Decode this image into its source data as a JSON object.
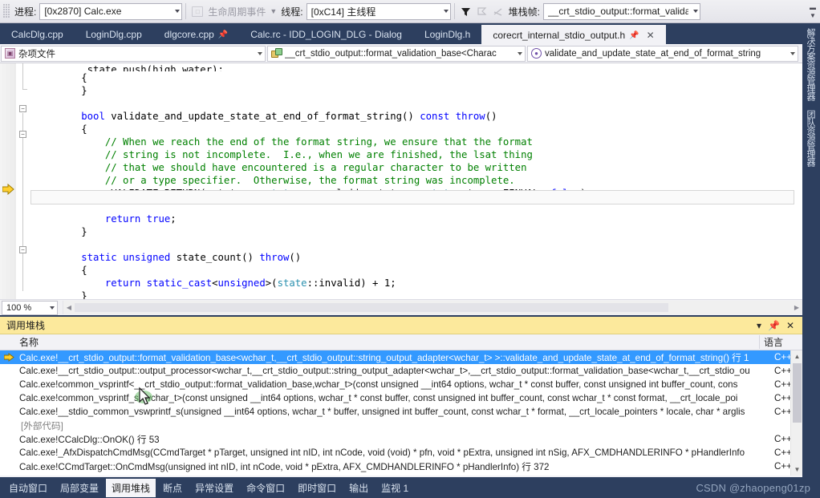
{
  "debug_toolbar": {
    "process_label": "进程:",
    "process_value": "[0x2870] Calc.exe",
    "lifecycle_label": "生命周期事件",
    "thread_label": "线程:",
    "thread_value": "[0xC14] 主线程",
    "frame_label": "堆栈帧:",
    "frame_value": "__crt_stdio_output::format_validation_b",
    "filter_icon": "funnel-icon",
    "flag_icon": "flag-icon",
    "nocross_icon": "no-cross-icon",
    "overflow_icon": "toolbar-overflow-icon"
  },
  "editor_tabs": [
    {
      "label": "CalcDlg.cpp",
      "active": false,
      "pinned": false
    },
    {
      "label": "LoginDlg.cpp",
      "active": false,
      "pinned": false
    },
    {
      "label": "dlgcore.cpp",
      "active": false,
      "pinned": true
    },
    {
      "label": "Calc.rc - IDD_LOGIN_DLG - Dialog",
      "active": false,
      "pinned": false
    },
    {
      "label": "LoginDlg.h",
      "active": false,
      "pinned": false
    },
    {
      "label": "corecrt_internal_stdio_output.h",
      "active": true,
      "pinned": true
    }
  ],
  "navbar": {
    "project": "杂项文件",
    "project_icon": "misc-files-icon",
    "class": "__crt_stdio_output::format_validation_base<Charac",
    "class_icon": "class-icon",
    "member": "validate_and_update_state_at_end_of_format_string",
    "member_icon": "method-icon"
  },
  "editor": {
    "zoom": "100 %",
    "lines": [
      {
        "indent": 2,
        "tokens": [
          {
            "t": "_state.push(high_water);",
            "c": "plain"
          }
        ],
        "clipped": true
      },
      {
        "indent": 2,
        "tokens": [
          {
            "t": "{",
            "c": "plain"
          }
        ]
      },
      {
        "indent": 2,
        "tokens": [
          {
            "t": "}",
            "c": "plain"
          }
        ]
      },
      {
        "indent": 0,
        "tokens": []
      },
      {
        "indent": 2,
        "tokens": [
          {
            "t": "bool",
            "c": "kw"
          },
          {
            "t": " validate_and_update_state_at_end_of_format_string() ",
            "c": "plain"
          },
          {
            "t": "const",
            "c": "kw"
          },
          {
            "t": " ",
            "c": "plain"
          },
          {
            "t": "throw",
            "c": "kw"
          },
          {
            "t": "()",
            "c": "plain"
          }
        ]
      },
      {
        "indent": 2,
        "tokens": [
          {
            "t": "{",
            "c": "plain"
          }
        ]
      },
      {
        "indent": 3,
        "tokens": [
          {
            "t": "// When we reach the end of the format string, we ensure that the format",
            "c": "cmt"
          }
        ]
      },
      {
        "indent": 3,
        "tokens": [
          {
            "t": "// string is not incomplete.  I.e., when we are finished, the lsat thing",
            "c": "cmt"
          }
        ]
      },
      {
        "indent": 3,
        "tokens": [
          {
            "t": "// that we should have encountered is a regular character to be written",
            "c": "cmt"
          }
        ]
      },
      {
        "indent": 3,
        "tokens": [
          {
            "t": "// or a type specifier.  Otherwise, the format string was incomplete.",
            "c": "cmt"
          }
        ]
      },
      {
        "indent": 3,
        "current": true,
        "tokens": [
          {
            "t": "_VALIDATE_RETURN(_state == ",
            "c": "plain"
          },
          {
            "t": "state",
            "c": "typ"
          },
          {
            "t": "::normal || _state == ",
            "c": "plain"
          },
          {
            "t": "state",
            "c": "typ"
          },
          {
            "t": "::type, EINVAL, ",
            "c": "plain"
          },
          {
            "t": "false",
            "c": "kw"
          },
          {
            "t": ");",
            "c": "plain"
          }
        ]
      },
      {
        "indent": 0,
        "tokens": []
      },
      {
        "indent": 3,
        "tokens": [
          {
            "t": "return",
            "c": "kw"
          },
          {
            "t": " ",
            "c": "plain"
          },
          {
            "t": "true",
            "c": "kw"
          },
          {
            "t": ";",
            "c": "plain"
          }
        ]
      },
      {
        "indent": 2,
        "tokens": [
          {
            "t": "}",
            "c": "plain"
          }
        ]
      },
      {
        "indent": 0,
        "tokens": []
      },
      {
        "indent": 2,
        "tokens": [
          {
            "t": "static",
            "c": "kw"
          },
          {
            "t": " ",
            "c": "plain"
          },
          {
            "t": "unsigned",
            "c": "kw"
          },
          {
            "t": " state_count() ",
            "c": "plain"
          },
          {
            "t": "throw",
            "c": "kw"
          },
          {
            "t": "()",
            "c": "plain"
          }
        ]
      },
      {
        "indent": 2,
        "tokens": [
          {
            "t": "{",
            "c": "plain"
          }
        ]
      },
      {
        "indent": 3,
        "tokens": [
          {
            "t": "return",
            "c": "kw"
          },
          {
            "t": " ",
            "c": "plain"
          },
          {
            "t": "static_cast",
            "c": "kw"
          },
          {
            "t": "<",
            "c": "plain"
          },
          {
            "t": "unsigned",
            "c": "kw"
          },
          {
            "t": ">(",
            "c": "plain"
          },
          {
            "t": "state",
            "c": "typ"
          },
          {
            "t": "::invalid) + 1;",
            "c": "plain"
          }
        ]
      },
      {
        "indent": 2,
        "tokens": [
          {
            "t": "}",
            "c": "plain"
          }
        ]
      }
    ]
  },
  "right_dock": {
    "items": [
      "解决方案资源管理器",
      "团队资源管理器"
    ]
  },
  "call_stack": {
    "title": "调用堆栈",
    "panel_caret_icon": "chevron-down-icon",
    "panel_pin_icon": "pin-icon",
    "panel_close_icon": "close-icon",
    "columns": {
      "name": "名称",
      "language": "语言"
    },
    "rows": [
      {
        "name": "Calc.exe!__crt_stdio_output::format_validation_base<wchar_t,__crt_stdio_output::string_output_adapter<wchar_t> >::validate_and_update_state_at_end_of_format_string() 行 1",
        "lang": "C++",
        "selected": true,
        "current": true
      },
      {
        "name": "Calc.exe!__crt_stdio_output::output_processor<wchar_t,__crt_stdio_output::string_output_adapter<wchar_t>,__crt_stdio_output::format_validation_base<wchar_t,__crt_stdio_ou",
        "lang": "C++",
        "selected": false,
        "current": false
      },
      {
        "name": "Calc.exe!common_vsprintf<__crt_stdio_output::format_validation_base,wchar_t>(const unsigned __int64 options, wchar_t * const buffer, const unsigned int buffer_count, cons",
        "lang": "C++",
        "selected": false,
        "current": false
      },
      {
        "name": "Calc.exe!common_vsprintf_s<wchar_t>(const unsigned __int64 options, wchar_t * const buffer, const unsigned int buffer_count, const wchar_t * const format, __crt_locale_poi",
        "lang": "C++",
        "selected": false,
        "current": false
      },
      {
        "name": "Calc.exe!__stdio_common_vswprintf_s(unsigned __int64 options, wchar_t * buffer, unsigned int buffer_count, const wchar_t * format, __crt_locale_pointers * locale, char * arglis",
        "lang": "C++",
        "selected": false,
        "current": false
      },
      {
        "name": "[外部代码]",
        "lang": "",
        "selected": false,
        "current": false,
        "external": true
      },
      {
        "name": "Calc.exe!CCalcDlg::OnOK() 行 53",
        "lang": "C++",
        "selected": false,
        "current": false
      },
      {
        "name": "Calc.exe!_AfxDispatchCmdMsg(CCmdTarget * pTarget, unsigned int nID, int nCode, void (void) * pfn, void * pExtra, unsigned int nSig, AFX_CMDHANDLERINFO * pHandlerInfo",
        "lang": "C++",
        "selected": false,
        "current": false
      },
      {
        "name": "Calc.exe!CCmdTarget::OnCmdMsg(unsigned int nID, int nCode, void * pExtra, AFX_CMDHANDLERINFO * pHandlerInfo) 行 372",
        "lang": "C++",
        "selected": false,
        "current": false
      }
    ]
  },
  "bottom_tabs": [
    {
      "label": "自动窗口",
      "active": false
    },
    {
      "label": "局部变量",
      "active": false
    },
    {
      "label": "调用堆栈",
      "active": true
    },
    {
      "label": "断点",
      "active": false
    },
    {
      "label": "异常设置",
      "active": false
    },
    {
      "label": "命令窗口",
      "active": false
    },
    {
      "label": "即时窗口",
      "active": false
    },
    {
      "label": "输出",
      "active": false
    },
    {
      "label": "监视 1",
      "active": false
    }
  ],
  "watermark": "CSDN @zhaopeng01zp",
  "colors": {
    "chrome": "#2d3f5f",
    "panel_title": "#fce99c",
    "selection": "#3399ff",
    "keyword": "#0000ff",
    "comment": "#008000",
    "type": "#2b91af"
  }
}
